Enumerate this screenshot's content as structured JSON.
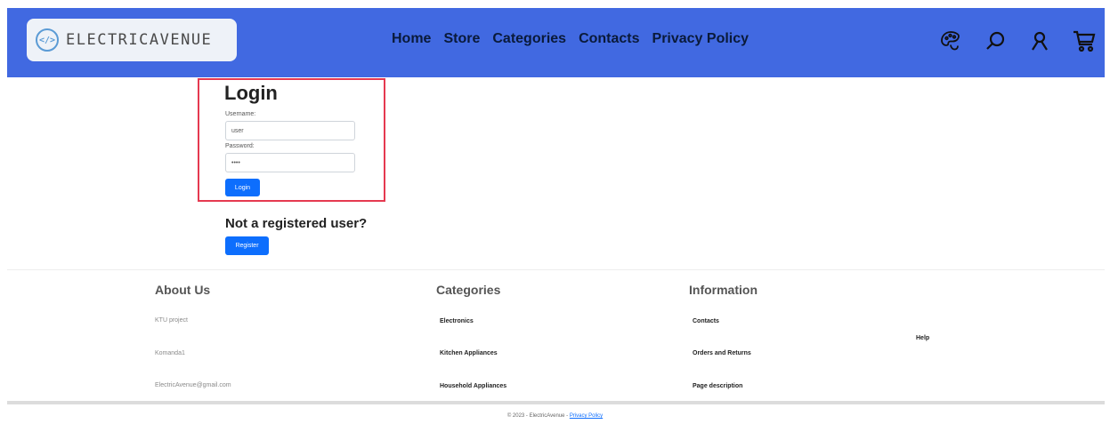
{
  "header": {
    "brand_icon_text": "</>",
    "brand_name": "ELECTRICAVENUE",
    "nav": [
      "Home",
      "Store",
      "Categories",
      "Contacts",
      "Privacy Policy"
    ],
    "icons": [
      "palette-icon",
      "search-icon",
      "user-icon",
      "cart-icon"
    ],
    "background_color": "#4169e1"
  },
  "login": {
    "title": "Login",
    "username_label": "Username:",
    "username_value": "user",
    "password_label": "Password:",
    "password_value": "••••",
    "submit_label": "Login",
    "highlight_color": "#e53950"
  },
  "register": {
    "heading": "Not a registered user?",
    "button_label": "Register"
  },
  "footer": {
    "about": {
      "heading": "About Us",
      "items": [
        "KTU project",
        "Komanda1",
        "ElectricAvenue@gmail.com"
      ]
    },
    "categories": {
      "heading": "Categories",
      "items": [
        "Electronics",
        "Kitchen Appliances",
        "Household Appliances"
      ]
    },
    "information": {
      "heading": "Information",
      "items": [
        "Contacts",
        "Orders and Returns",
        "Page description"
      ]
    },
    "help": "Help",
    "copyright": "© 2023 - ElectricAvenue - ",
    "copyright_link": "Privacy Policy"
  }
}
